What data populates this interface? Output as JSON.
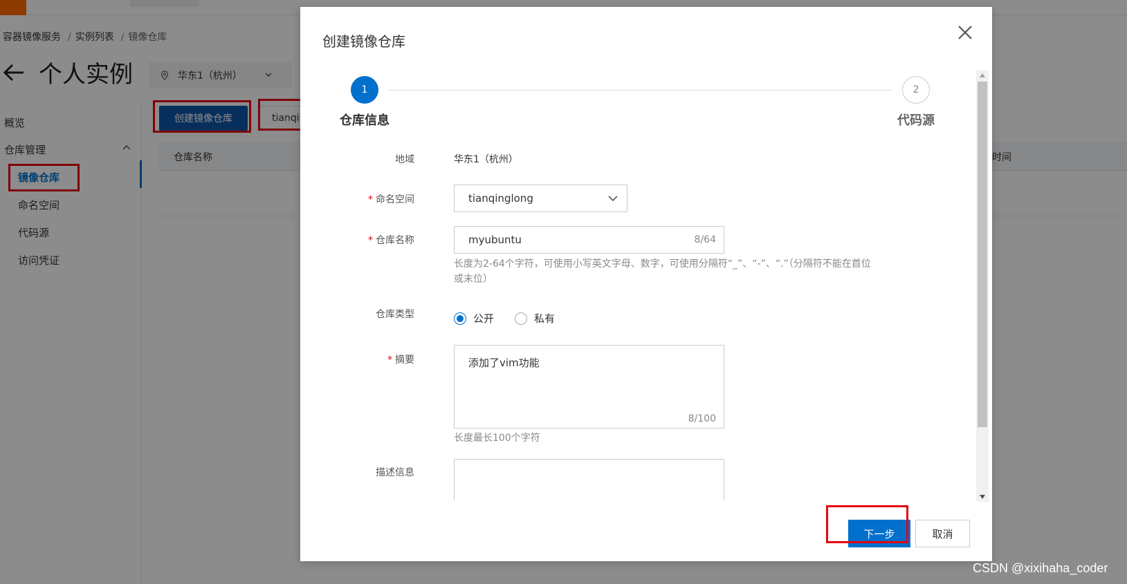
{
  "background": {
    "breadcrumb": [
      "容器镜像服务",
      "实例列表",
      "镜像仓库"
    ],
    "breadcrumb_sep": "/",
    "back_icon": "arrow-left-icon",
    "page_title": "个人实例",
    "region": "华东1（杭州）",
    "sidebar": {
      "overview": "概览",
      "repo_management": "仓库管理",
      "items": [
        "镜像仓库",
        "命名空间",
        "代码源",
        "访问凭证"
      ]
    },
    "create_button": "创建镜像仓库",
    "namespace_select": "tianqinglong",
    "table_columns": [
      "仓库名称",
      "时间"
    ]
  },
  "modal": {
    "title": "创建镜像仓库",
    "steps": [
      {
        "number": "1",
        "label": "仓库信息"
      },
      {
        "number": "2",
        "label": "代码源"
      }
    ],
    "fields": {
      "region": {
        "label": "地域",
        "value": "华东1（杭州）"
      },
      "namespace": {
        "label": "命名空间",
        "value": "tianqinglong"
      },
      "repo_name": {
        "label": "仓库名称",
        "value": "myubuntu",
        "count": "8/64",
        "hint_line1": "长度为2-64个字符，可使用小写英文字母、数字，可使用分隔符“_”、“-”、“.”（分隔符不能在首位",
        "hint_line2": "或末位）"
      },
      "repo_type": {
        "label": "仓库类型",
        "options": [
          "公开",
          "私有"
        ],
        "selected": "公开"
      },
      "summary": {
        "label": "摘要",
        "value": "添加了vim功能",
        "count": "8/100",
        "hint": "长度最长100个字符"
      },
      "description": {
        "label": "描述信息"
      }
    },
    "required_mark": "*",
    "buttons": {
      "next": "下一步",
      "cancel": "取消"
    }
  },
  "watermark": "CSDN @xixihaha_coder",
  "colors": {
    "primary": "#0070cc",
    "highlight_box": "#e60012",
    "required": "#e60012"
  }
}
